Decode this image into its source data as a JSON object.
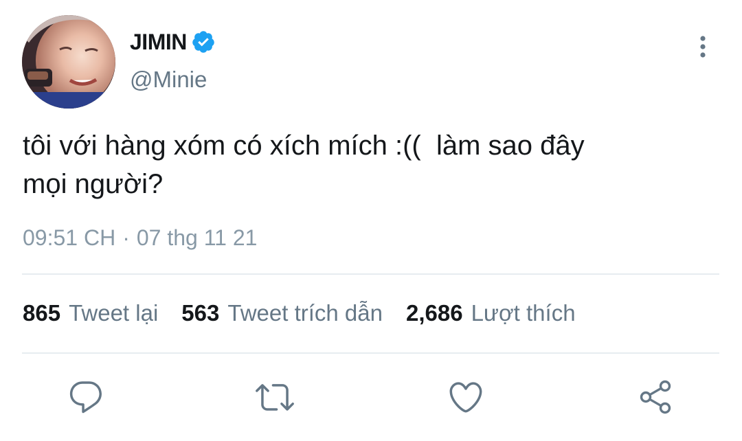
{
  "tweet": {
    "author": {
      "display_name": "JIMIN",
      "handle": "@Minie",
      "verified": true,
      "verified_icon": "verified-badge-icon",
      "avatar_icon": "profile-photo"
    },
    "text": "tôi với hàng xóm có xích mích :((  làm sao đây\nmọi người?",
    "time": "09:51 CH",
    "separator": "·",
    "date": "07 thg 11 21"
  },
  "stats": {
    "retweets": {
      "count": "865",
      "label": "Tweet lại"
    },
    "quotes": {
      "count": "563",
      "label": "Tweet trích dẫn"
    },
    "likes": {
      "count": "2,686",
      "label": "Lượt thích"
    }
  },
  "actions": [
    {
      "name": "reply",
      "icon": "speech-bubble-icon"
    },
    {
      "name": "retweet",
      "icon": "retweet-arrows-icon"
    },
    {
      "name": "like",
      "icon": "heart-icon"
    },
    {
      "name": "share",
      "icon": "share-nodes-icon"
    }
  ],
  "menu_icon": "vertical-ellipsis-icon",
  "colors": {
    "verified_blue": "#1da1f2",
    "text_primary": "#14171a",
    "text_secondary": "#657786",
    "icon_gray": "#657786",
    "divider": "#e6ecf0"
  }
}
